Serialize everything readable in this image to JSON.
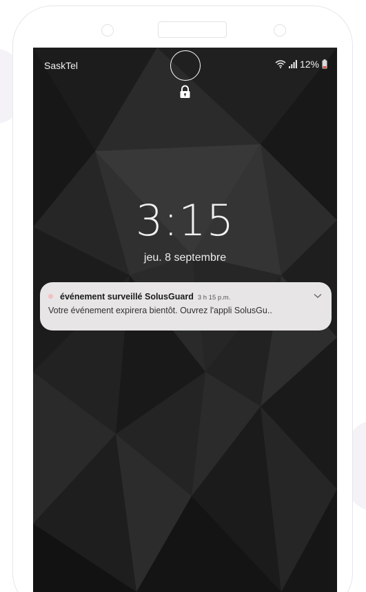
{
  "status_bar": {
    "carrier": "SaskTel",
    "battery_percent": "12%",
    "icons": [
      "wifi-icon",
      "signal-icon",
      "battery-icon"
    ]
  },
  "lock_screen": {
    "icons": [
      "unlock-ring-icon",
      "lock-icon"
    ],
    "time": "3:15",
    "date": "jeu. 8 septembre"
  },
  "notification": {
    "title": "événement surveillé SolusGuard",
    "time": "3 h 15 p.m.",
    "body": "Votre événement expirera bientôt. Ouvrez l'appli SolusGu..",
    "expand_icon": "chevron-down-icon",
    "background_color": "#e7e5e5"
  },
  "colors": {
    "screen_background": "#262626",
    "text_on_dark": "#f0f0f0"
  }
}
